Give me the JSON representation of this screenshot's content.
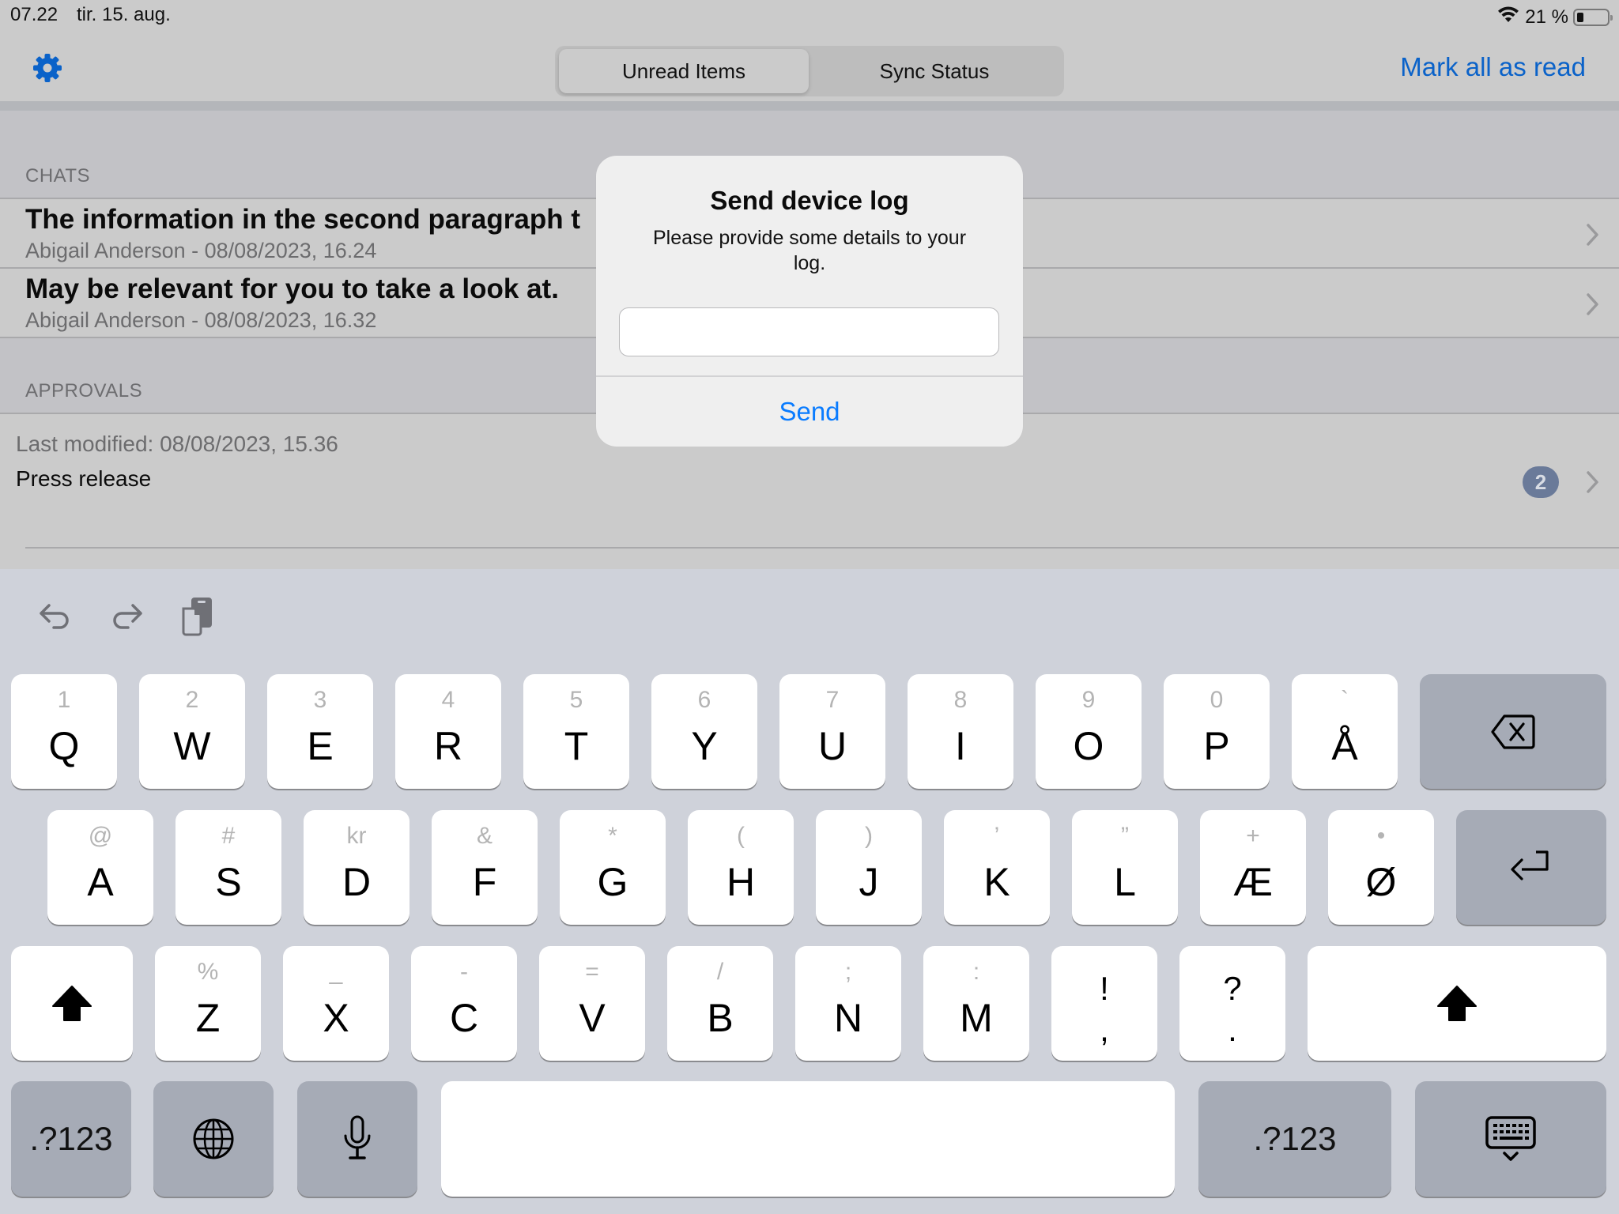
{
  "status_bar": {
    "time": "07.22",
    "date": "tir. 15. aug.",
    "battery_text": "21 %",
    "battery_level": 0.21,
    "icons": [
      "wifi-icon",
      "battery-icon"
    ]
  },
  "nav": {
    "settings_icon": "gear-icon",
    "segments": [
      {
        "label": "Unread Items",
        "selected": true
      },
      {
        "label": "Sync Status",
        "selected": false
      }
    ],
    "mark_all_label": "Mark all as read",
    "accent_color": "#0a62c9"
  },
  "sections": {
    "chats": {
      "header": "CHATS",
      "items": [
        {
          "title": "The information in the second paragraph t",
          "subtitle": "Abigail Anderson - 08/08/2023, 16.24"
        },
        {
          "title": "May be relevant for you to take a look at.",
          "subtitle": "Abigail Anderson - 08/08/2023, 16.32"
        }
      ]
    },
    "approvals": {
      "header": "APPROVALS",
      "items": [
        {
          "meta": "Last modified: 08/08/2023, 15.36",
          "title": "Press release",
          "badge": "2"
        }
      ]
    }
  },
  "alert": {
    "title": "Send device log",
    "message": "Please provide some details to your log.",
    "input_value": "",
    "input_placeholder": "",
    "button_label": "Send",
    "button_color": "#0a7cff"
  },
  "keyboard": {
    "toolbar": [
      "undo-icon",
      "redo-icon",
      "paste-icon"
    ],
    "row1": [
      {
        "main": "Q",
        "alt": "1"
      },
      {
        "main": "W",
        "alt": "2"
      },
      {
        "main": "E",
        "alt": "3"
      },
      {
        "main": "R",
        "alt": "4"
      },
      {
        "main": "T",
        "alt": "5"
      },
      {
        "main": "Y",
        "alt": "6"
      },
      {
        "main": "U",
        "alt": "7"
      },
      {
        "main": "I",
        "alt": "8"
      },
      {
        "main": "O",
        "alt": "9"
      },
      {
        "main": "P",
        "alt": "0"
      },
      {
        "main": "Å",
        "alt": "`"
      }
    ],
    "row2": [
      {
        "main": "A",
        "alt": "@"
      },
      {
        "main": "S",
        "alt": "#"
      },
      {
        "main": "D",
        "alt": "kr"
      },
      {
        "main": "F",
        "alt": "&"
      },
      {
        "main": "G",
        "alt": "*"
      },
      {
        "main": "H",
        "alt": "("
      },
      {
        "main": "J",
        "alt": ")"
      },
      {
        "main": "K",
        "alt": "’"
      },
      {
        "main": "L",
        "alt": "”"
      },
      {
        "main": "Æ",
        "alt": "+"
      },
      {
        "main": "Ø",
        "alt": "•"
      }
    ],
    "row3": [
      {
        "main": "Z",
        "alt": "%"
      },
      {
        "main": "X",
        "alt": "_"
      },
      {
        "main": "C",
        "alt": "-"
      },
      {
        "main": "V",
        "alt": "="
      },
      {
        "main": "B",
        "alt": "/"
      },
      {
        "main": "N",
        "alt": ";"
      },
      {
        "main": "M",
        "alt": ":"
      }
    ],
    "punct_keys": [
      {
        "top": "!",
        "bottom": ","
      },
      {
        "top": "?",
        "bottom": "."
      }
    ],
    "numbers_label": ".?123",
    "special_icons": [
      "backspace-icon",
      "return-icon",
      "shift-icon",
      "globe-icon",
      "microphone-icon",
      "keyboard-dismiss-icon"
    ]
  }
}
